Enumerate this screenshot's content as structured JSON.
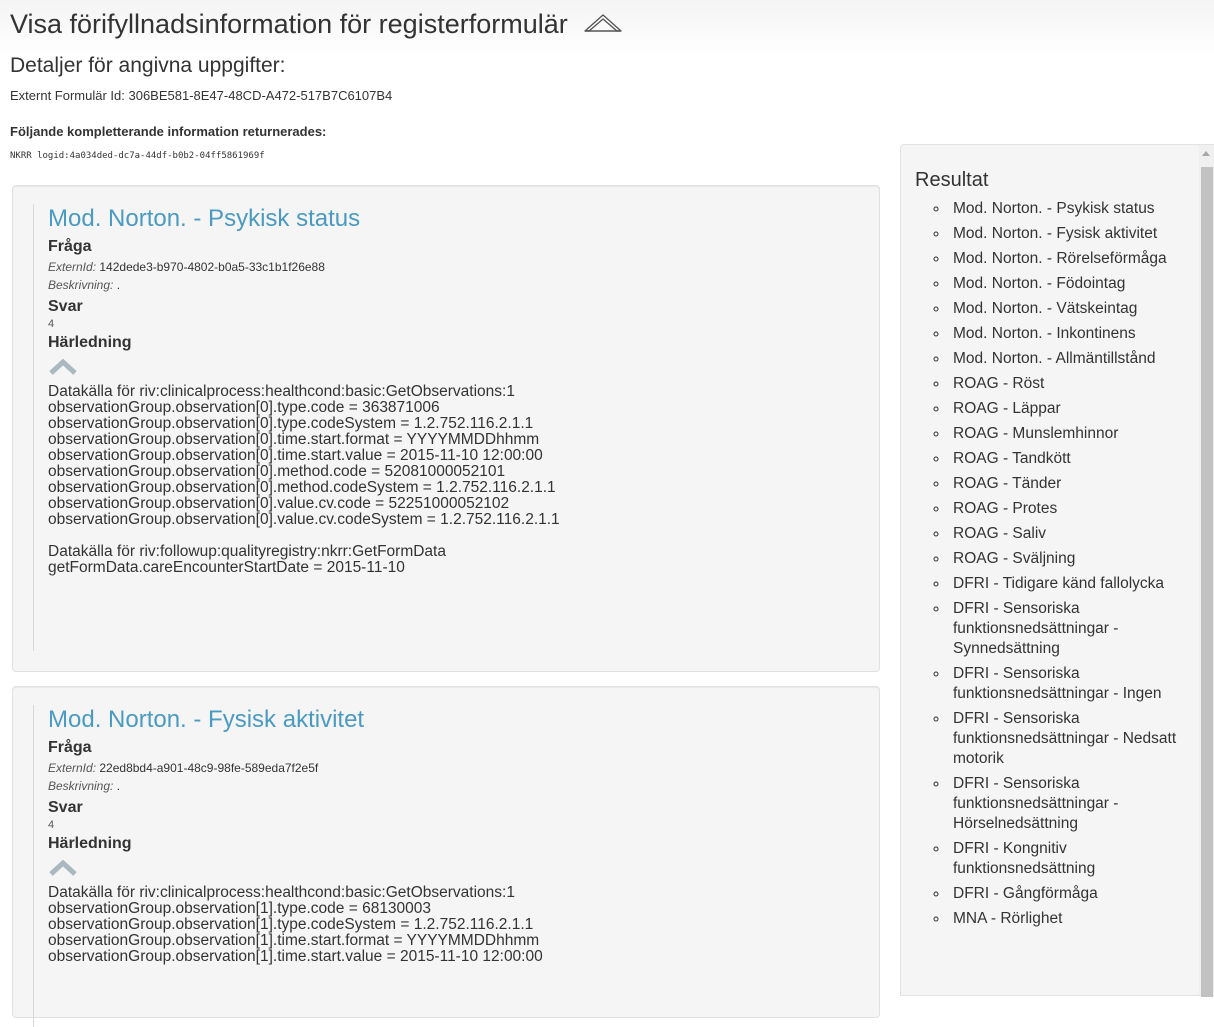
{
  "header": {
    "title": "Visa förifyllnadsinformation för registerformulär",
    "subtitle": "Detaljer för angivna uppgifter:",
    "external_form_id_label": "Externt Formulär Id: 306BE581-8E47-48CD-A472-517B7C6107B4",
    "additional_info_label": "Följande kompletterande information returnerades:",
    "logid": "NKRR logid:4a034ded-dc7a-44df-b0b2-04ff5861969f",
    "collapse_icon": "chevron-up-outline-icon"
  },
  "labels": {
    "question": "Fråga",
    "external_id": "ExternId:",
    "description": "Beskrivning:",
    "answer": "Svar",
    "derivation": "Härledning"
  },
  "questions": [
    {
      "title": "Mod. Norton. - Psykisk status",
      "external_id": "142dede3-b970-4802-b0a5-33c1b1f26e88",
      "description": ".",
      "answer": "4",
      "derivation_blocks": [
        [
          "Datakälla för riv:clinicalprocess:healthcond:basic:GetObservations:1",
          "observationGroup.observation[0].type.code = 363871006",
          "observationGroup.observation[0].type.codeSystem = 1.2.752.116.2.1.1",
          "observationGroup.observation[0].time.start.format = YYYYMMDDhhmm",
          "observationGroup.observation[0].time.start.value = 2015-11-10 12:00:00",
          "observationGroup.observation[0].method.code = 52081000052101",
          "observationGroup.observation[0].method.codeSystem = 1.2.752.116.2.1.1",
          "observationGroup.observation[0].value.cv.code = 52251000052102",
          "observationGroup.observation[0].value.cv.codeSystem = 1.2.752.116.2.1.1"
        ],
        [
          "Datakälla för riv:followup:qualityregistry:nkrr:GetFormData",
          "getFormData.careEncounterStartDate = 2015-11-10"
        ]
      ]
    },
    {
      "title": "Mod. Norton. - Fysisk aktivitet",
      "external_id": "22ed8bd4-a901-48c9-98fe-589eda7f2e5f",
      "description": ".",
      "answer": "4",
      "derivation_blocks": [
        [
          "Datakälla för riv:clinicalprocess:healthcond:basic:GetObservations:1",
          "observationGroup.observation[1].type.code = 68130003",
          "observationGroup.observation[1].type.codeSystem = 1.2.752.116.2.1.1",
          "observationGroup.observation[1].time.start.format = YYYYMMDDhhmm",
          "observationGroup.observation[1].time.start.value = 2015-11-10 12:00:00"
        ]
      ]
    }
  ],
  "sidebar": {
    "title": "Resultat",
    "items": [
      "Mod. Norton. - Psykisk status",
      "Mod. Norton. - Fysisk aktivitet",
      "Mod. Norton. - Rörelseförmåga",
      "Mod. Norton. - Födointag",
      "Mod. Norton. - Vätskeintag",
      "Mod. Norton. - Inkontinens",
      "Mod. Norton. - Allmäntillstånd",
      "ROAG - Röst",
      "ROAG - Läppar",
      "ROAG - Munslemhinnor",
      "ROAG - Tandkött",
      "ROAG - Tänder",
      "ROAG - Protes",
      "ROAG - Saliv",
      "ROAG - Sväljning",
      "DFRI - Tidigare känd fallolycka",
      "DFRI - Sensoriska funktionsnedsättningar - Synnedsättning",
      "DFRI - Sensoriska funktionsnedsättningar - Ingen",
      "DFRI - Sensoriska funktionsnedsättningar - Nedsatt motorik",
      "DFRI - Sensoriska funktionsnedsättningar - Hörselnedsättning",
      "DFRI - Kongnitiv funktionsnedsättning",
      "DFRI - Gångförmåga",
      "MNA - Rörlighet"
    ]
  },
  "colors": {
    "accent": "#4a9ac2",
    "panel_bg": "#f5f5f5",
    "text": "#333333"
  }
}
